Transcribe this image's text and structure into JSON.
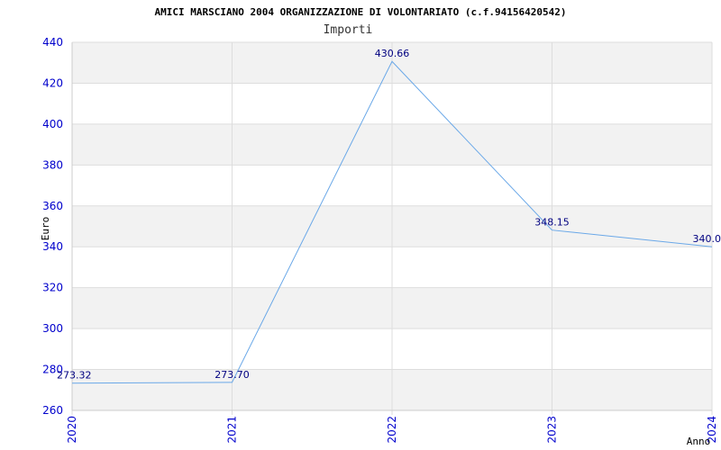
{
  "chart_data": {
    "type": "line",
    "title": "AMICI MARSCIANO 2004 ORGANIZZAZIONE DI VOLONTARIATO (c.f.94156420542)",
    "subtitle": "Importi",
    "xlabel": "Anno",
    "ylabel": "Euro",
    "categories": [
      "2020",
      "2021",
      "2022",
      "2023",
      "2024"
    ],
    "values": [
      273.32,
      273.7,
      430.66,
      348.15,
      340.0
    ],
    "data_labels": [
      "273.32",
      "273.70",
      "430.66",
      "348.15",
      "340.0"
    ],
    "ylim": [
      260,
      440
    ],
    "yticks": [
      "260",
      "280",
      "300",
      "320",
      "340",
      "360",
      "380",
      "400",
      "420",
      "440"
    ],
    "grid": true,
    "legend": "none",
    "colors": {
      "line": "#6aa8e8",
      "tick_labels": "#0000cc",
      "data_labels": "#000080",
      "band": "#f2f2f2",
      "grid": "#dddddd",
      "axis": "#cccccc"
    }
  }
}
